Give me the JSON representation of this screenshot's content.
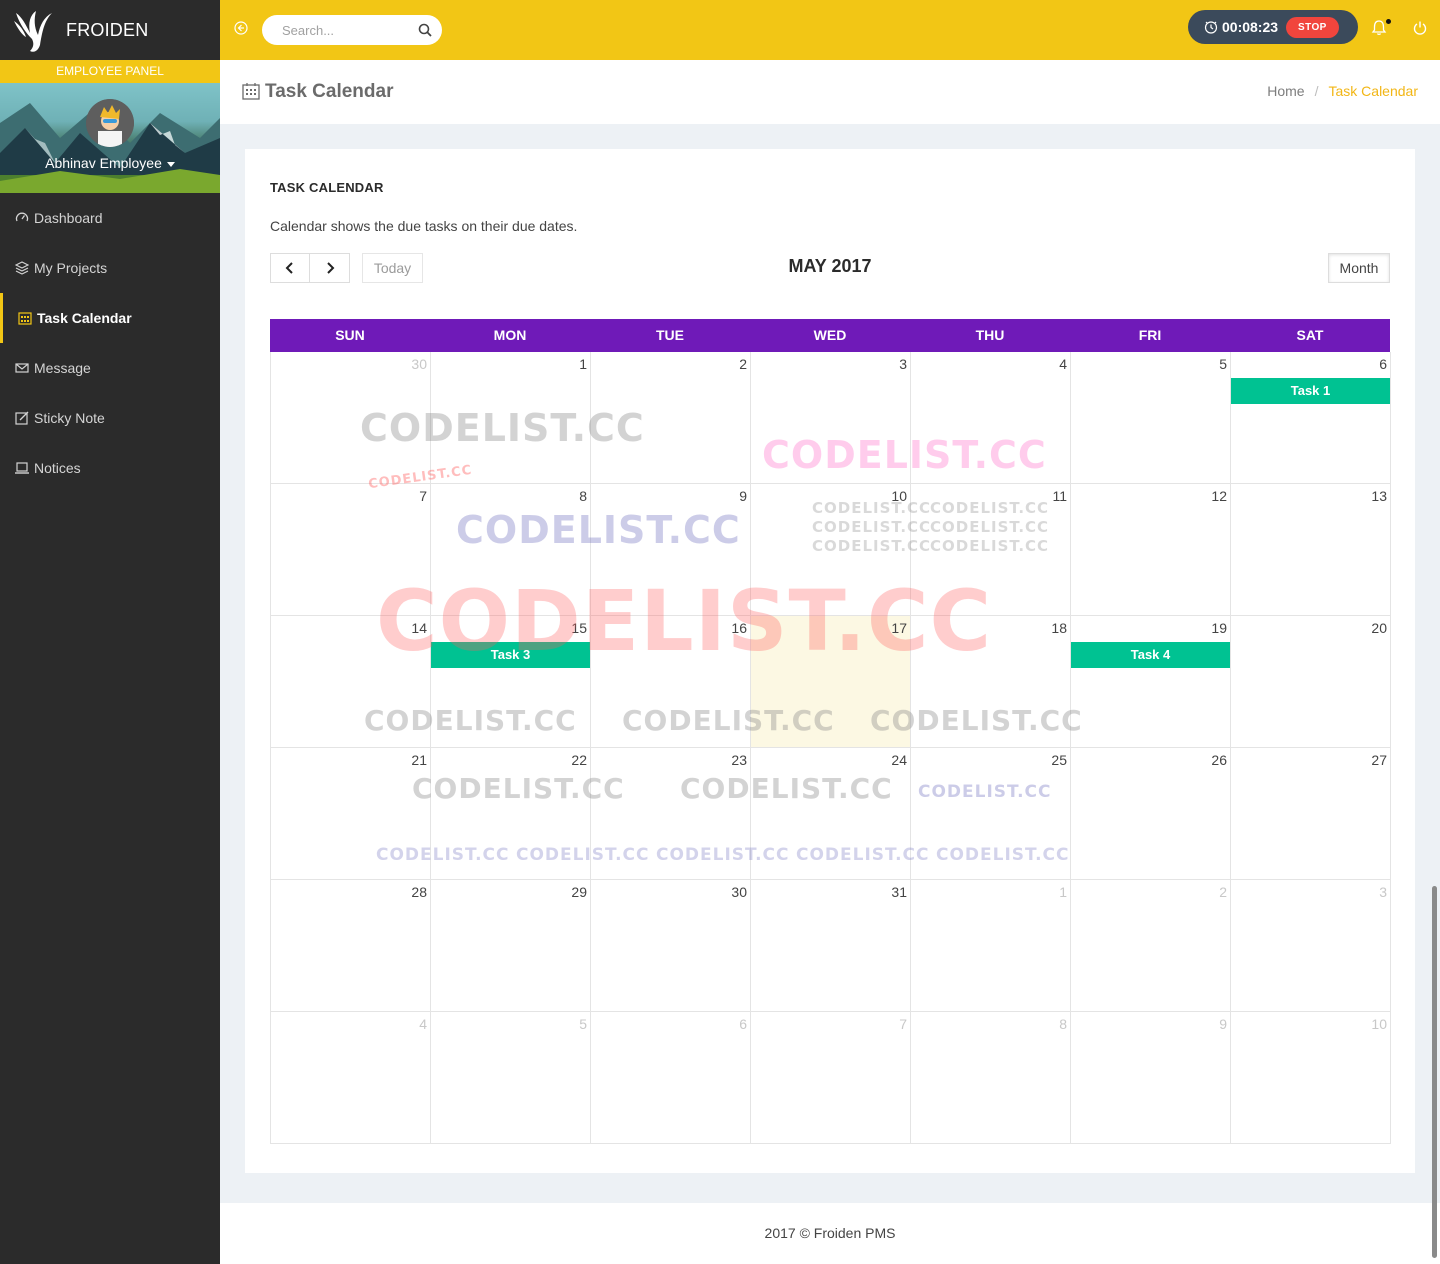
{
  "brand": {
    "name": "FROIDEN",
    "panel_label": "EMPLOYEE PANEL"
  },
  "profile": {
    "name": "Abhinav Employee"
  },
  "nav": [
    {
      "label": "Dashboard",
      "icon": "dashboard-icon"
    },
    {
      "label": "My Projects",
      "icon": "layers-icon"
    },
    {
      "label": "Task Calendar",
      "icon": "calendar-icon",
      "active": true
    },
    {
      "label": "Message",
      "icon": "envelope-icon"
    },
    {
      "label": "Sticky Note",
      "icon": "note-icon"
    },
    {
      "label": "Notices",
      "icon": "laptop-icon"
    }
  ],
  "topbar": {
    "search_placeholder": "Search...",
    "timer": "00:08:23",
    "stop_label": "STOP"
  },
  "page": {
    "title": "Task Calendar",
    "breadcrumb": {
      "home": "Home",
      "current": "Task Calendar"
    }
  },
  "panel": {
    "heading": "TASK CALENDAR",
    "description": "Calendar shows the due tasks on their due dates."
  },
  "calendar": {
    "title": "MAY 2017",
    "today_label": "Today",
    "view_label": "Month",
    "weekdays": [
      "SUN",
      "MON",
      "TUE",
      "WED",
      "THU",
      "FRI",
      "SAT"
    ],
    "days": [
      {
        "n": "30",
        "other": true
      },
      {
        "n": "1"
      },
      {
        "n": "2"
      },
      {
        "n": "3"
      },
      {
        "n": "4"
      },
      {
        "n": "5"
      },
      {
        "n": "6",
        "event": "Task 1"
      },
      {
        "n": "7"
      },
      {
        "n": "8"
      },
      {
        "n": "9"
      },
      {
        "n": "10"
      },
      {
        "n": "11"
      },
      {
        "n": "12"
      },
      {
        "n": "13"
      },
      {
        "n": "14"
      },
      {
        "n": "15",
        "event": "Task 3"
      },
      {
        "n": "16"
      },
      {
        "n": "17",
        "today": true
      },
      {
        "n": "18"
      },
      {
        "n": "19",
        "event": "Task 4"
      },
      {
        "n": "20"
      },
      {
        "n": "21"
      },
      {
        "n": "22"
      },
      {
        "n": "23"
      },
      {
        "n": "24"
      },
      {
        "n": "25"
      },
      {
        "n": "26"
      },
      {
        "n": "27"
      },
      {
        "n": "28"
      },
      {
        "n": "29"
      },
      {
        "n": "30"
      },
      {
        "n": "31"
      },
      {
        "n": "1",
        "other": true
      },
      {
        "n": "2",
        "other": true
      },
      {
        "n": "3",
        "other": true
      },
      {
        "n": "4",
        "other": true
      },
      {
        "n": "5",
        "other": true
      },
      {
        "n": "6",
        "other": true
      },
      {
        "n": "7",
        "other": true
      },
      {
        "n": "8",
        "other": true
      },
      {
        "n": "9",
        "other": true
      },
      {
        "n": "10",
        "other": true
      }
    ]
  },
  "footer": {
    "text": "2017 © Froiden PMS"
  },
  "watermark": "CODELIST.CC",
  "colors": {
    "accent": "#f2c615",
    "sidebar": "#2b2b2b",
    "calendar_header": "#6f1ab8",
    "event": "#00c292",
    "stop": "#f1453d"
  }
}
